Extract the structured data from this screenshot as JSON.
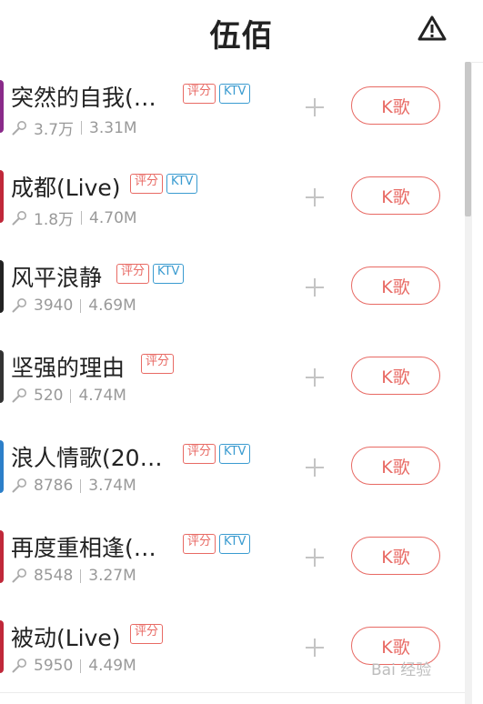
{
  "header": {
    "title": "伍佰",
    "warning_icon": "warning-triangle-icon"
  },
  "colors": {
    "accent": "#e86a64",
    "ktv": "#3a9bd0",
    "muted": "#999999"
  },
  "tag_labels": {
    "score": "评分",
    "ktv": "KTV"
  },
  "button_label": "K歌",
  "songs": [
    {
      "name": "突然的自我(…",
      "count": "3.7万",
      "size": "3.31M",
      "score_tag": true,
      "ktv_tag": true,
      "cover_color": "#8a2a8a"
    },
    {
      "name": "成都(Live)",
      "count": "1.8万",
      "size": "4.70M",
      "score_tag": true,
      "ktv_tag": true,
      "cover_color": "#c0283a"
    },
    {
      "name": "风平浪静",
      "count": "3940",
      "size": "4.69M",
      "score_tag": true,
      "ktv_tag": true,
      "cover_color": "#222222"
    },
    {
      "name": "坚强的理由",
      "count": "520",
      "size": "4.74M",
      "score_tag": true,
      "ktv_tag": false,
      "cover_color": "#333333"
    },
    {
      "name": "浪人情歌(20…",
      "count": "8786",
      "size": "3.74M",
      "score_tag": true,
      "ktv_tag": true,
      "cover_color": "#2c7fc9"
    },
    {
      "name": "再度重相逢(…",
      "count": "8548",
      "size": "3.27M",
      "score_tag": true,
      "ktv_tag": true,
      "cover_color": "#c0283a"
    },
    {
      "name": "被动(Live)",
      "count": "5950",
      "size": "4.49M",
      "score_tag": true,
      "ktv_tag": false,
      "cover_color": "#c0283a"
    }
  ],
  "watermark": "Bai 经验"
}
